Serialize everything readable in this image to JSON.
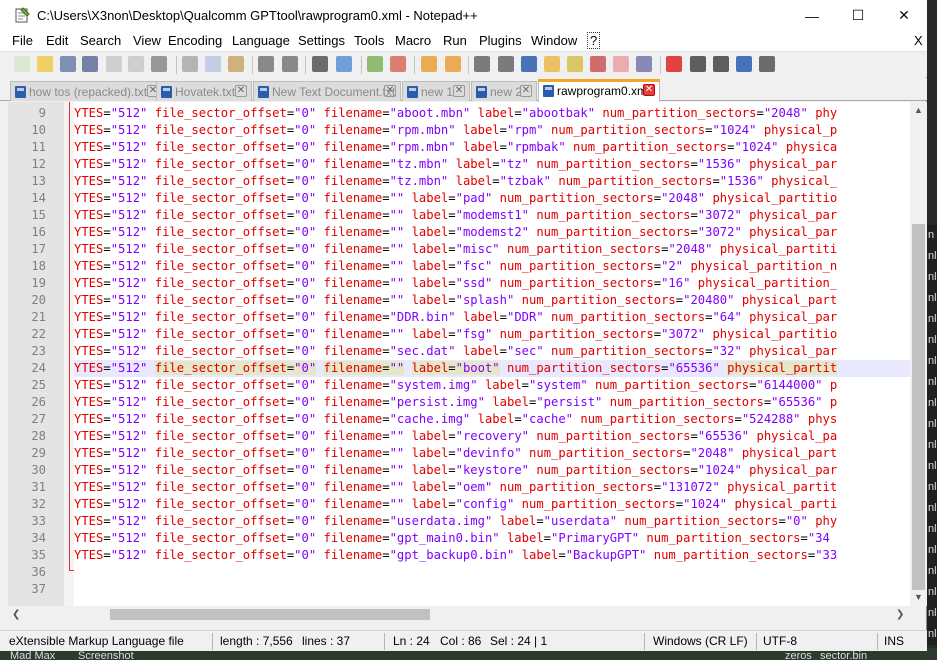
{
  "window": {
    "title": "C:\\Users\\X3non\\Desktop\\Qualcomm GPTtool\\rawprogram0.xml - Notepad++",
    "min_label": "—",
    "max_label": "☐",
    "close_label": "✕"
  },
  "menu": [
    "File",
    "Edit",
    "Search",
    "View",
    "Encoding",
    "Language",
    "Settings",
    "Tools",
    "Macro",
    "Run",
    "Plugins",
    "Window",
    "?"
  ],
  "menu_close": "X",
  "tabs": [
    {
      "label": "how tos (repacked).txt",
      "active": false
    },
    {
      "label": "Hovatek.txt",
      "active": false
    },
    {
      "label": "New Text Document.txt",
      "active": false
    },
    {
      "label": "new 1",
      "active": false
    },
    {
      "label": "new 2",
      "active": false
    },
    {
      "label": "rawprogram0.xml",
      "active": true
    }
  ],
  "tab_close": "✕",
  "editor": {
    "current_line": 24,
    "lines": [
      {
        "n": 9,
        "filename": "aboot.mbn",
        "label": "abootbak",
        "attr": "num_partition_sectors",
        "val": "2048",
        "tail": "phy"
      },
      {
        "n": 10,
        "filename": "rpm.mbn",
        "label": "rpm",
        "attr": "num_partition_sectors",
        "val": "1024",
        "tail": "physical_p"
      },
      {
        "n": 11,
        "filename": "rpm.mbn",
        "label": "rpmbak",
        "attr": "num_partition_sectors",
        "val": "1024",
        "tail": "physica"
      },
      {
        "n": 12,
        "filename": "tz.mbn",
        "label": "tz",
        "attr": "num_partition_sectors",
        "val": "1536",
        "tail": "physical_par"
      },
      {
        "n": 13,
        "filename": "tz.mbn",
        "label": "tzbak",
        "attr": "num_partition_sectors",
        "val": "1536",
        "tail": "physical_"
      },
      {
        "n": 14,
        "filename": "",
        "label": "pad",
        "attr": "num_partition_sectors",
        "val": "2048",
        "tail": "physical_partitio"
      },
      {
        "n": 15,
        "filename": "",
        "label": "modemst1",
        "attr": "num_partition_sectors",
        "val": "3072",
        "tail": "physical_par"
      },
      {
        "n": 16,
        "filename": "",
        "label": "modemst2",
        "attr": "num_partition_sectors",
        "val": "3072",
        "tail": "physical_par"
      },
      {
        "n": 17,
        "filename": "",
        "label": "misc",
        "attr": "num_partition_sectors",
        "val": "2048",
        "tail": "physical_partiti"
      },
      {
        "n": 18,
        "filename": "",
        "label": "fsc",
        "attr": "num_partition_sectors",
        "val": "2",
        "tail": "physical_partition_n"
      },
      {
        "n": 19,
        "filename": "",
        "label": "ssd",
        "attr": "num_partition_sectors",
        "val": "16",
        "tail": "physical_partition_"
      },
      {
        "n": 20,
        "filename": "",
        "label": "splash",
        "attr": "num_partition_sectors",
        "val": "20480",
        "tail": "physical_part"
      },
      {
        "n": 21,
        "filename": "DDR.bin",
        "label": "DDR",
        "attr": "num_partition_sectors",
        "val": "64",
        "tail": "physical_par"
      },
      {
        "n": 22,
        "filename": "",
        "label": "fsg",
        "attr": "num_partition_sectors",
        "val": "3072",
        "tail": "physical_partitio"
      },
      {
        "n": 23,
        "filename": "sec.dat",
        "label": "sec",
        "attr": "num_partition_sectors",
        "val": "32",
        "tail": "physical_par"
      },
      {
        "n": 24,
        "filename": "",
        "label": "boot",
        "attr": "num_partition_sectors",
        "val": "65536",
        "tail": "physical_partit"
      },
      {
        "n": 25,
        "filename": "system.img",
        "label": "system",
        "attr": "num_partition_sectors",
        "val": "6144000",
        "tail": "p"
      },
      {
        "n": 26,
        "filename": "persist.img",
        "label": "persist",
        "attr": "num_partition_sectors",
        "val": "65536",
        "tail": "p"
      },
      {
        "n": 27,
        "filename": "cache.img",
        "label": "cache",
        "attr": "num_partition_sectors",
        "val": "524288",
        "tail": "phys"
      },
      {
        "n": 28,
        "filename": "",
        "label": "recovery",
        "attr": "num_partition_sectors",
        "val": "65536",
        "tail": "physical_pa"
      },
      {
        "n": 29,
        "filename": "",
        "label": "devinfo",
        "attr": "num_partition_sectors",
        "val": "2048",
        "tail": "physical_part"
      },
      {
        "n": 30,
        "filename": "",
        "label": "keystore",
        "attr": "num_partition_sectors",
        "val": "1024",
        "tail": "physical_par"
      },
      {
        "n": 31,
        "filename": "",
        "label": "oem",
        "attr": "num_partition_sectors",
        "val": "131072",
        "tail": "physical_partit"
      },
      {
        "n": 32,
        "filename": "",
        "label": "config",
        "attr": "num_partition_sectors",
        "val": "1024",
        "tail": "physical_parti"
      },
      {
        "n": 33,
        "filename": "userdata.img",
        "label": "userdata",
        "attr": "num_partition_sectors",
        "val": "0",
        "tail": "phy"
      },
      {
        "n": 34,
        "filename": "gpt_main0.bin",
        "label": "PrimaryGPT",
        "attr": "num_partition_sectors",
        "val": "34",
        "tail": "",
        "unterminated": true
      },
      {
        "n": 35,
        "filename": "gpt_backup0.bin",
        "label": "BackupGPT",
        "attr": "num_partition_sectors",
        "val": "33",
        "tail": "",
        "unterminated": true
      },
      {
        "n": 36,
        "empty": true
      },
      {
        "n": 37,
        "empty": true
      }
    ],
    "prefix_attr": "YTES",
    "prefix_val": "512",
    "offset_attr": "file_sector_offset",
    "offset_val": "0"
  },
  "status": {
    "file_type": "eXtensible Markup Language file",
    "length": "length : 7,556",
    "lines": "lines : 37",
    "ln": "Ln : 24",
    "col": "Col : 86",
    "sel": "Sel : 24 | 1",
    "eol": "Windows (CR LF)",
    "encoding": "UTF-8",
    "mode": "INS"
  },
  "background": {
    "bottom_items": [
      "Mad Max",
      "Screenshot",
      "zeros",
      "sector.bin"
    ],
    "right_chars": [
      "n",
      "nl",
      "nl",
      "nl",
      "nl",
      "nl",
      "nl",
      "nl",
      "nl",
      "nl",
      "nl",
      "nl",
      "nl",
      "nl",
      "nl",
      "nl",
      "nl",
      "nl",
      "nl",
      "nl"
    ]
  }
}
